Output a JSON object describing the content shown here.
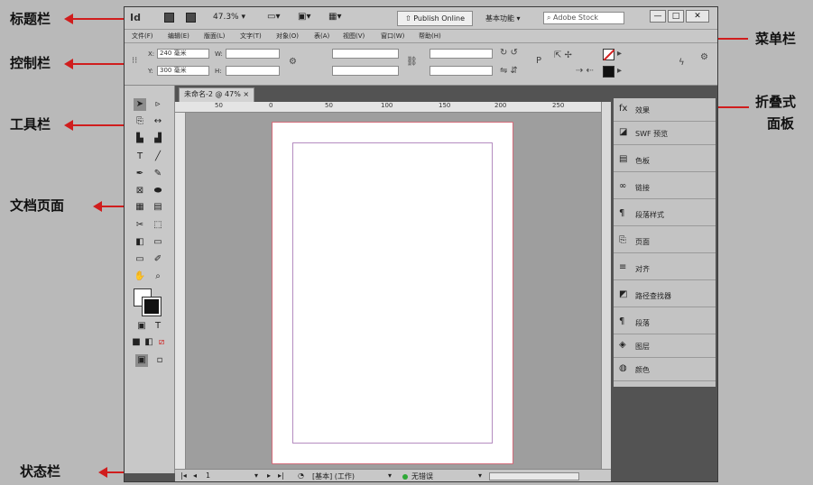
{
  "annotations": {
    "title_bar": "标题栏",
    "control_bar": "控制栏",
    "toolbar": "工具栏",
    "document_page": "文档页面",
    "status_bar": "状态栏",
    "menu_bar": "菜单栏",
    "collapsed_panels_line1": "折叠式",
    "collapsed_panels_line2": "面板"
  },
  "titlebar": {
    "logo": "Id",
    "zoom": "47.3%",
    "publish": "Publish Online",
    "workspace": "基本功能",
    "search_placeholder": "Adobe Stock",
    "minimize": "—",
    "maximize": "□",
    "close": "✕"
  },
  "menu": [
    "文件(F)",
    "编辑(E)",
    "版面(L)",
    "文字(T)",
    "对象(O)",
    "表(A)",
    "视图(V)",
    "窗口(W)",
    "帮助(H)"
  ],
  "control": {
    "x_label": "X:",
    "x_value": "240 毫米",
    "y_label": "Y:",
    "y_value": "300 毫米",
    "w_label": "W:",
    "h_label": "H:"
  },
  "document": {
    "tab_label": "未命名-2 @ 47% ×",
    "ruler_labels": [
      "50",
      "0",
      "50",
      "100",
      "150",
      "200",
      "250"
    ]
  },
  "status": {
    "page": "1",
    "profile": "[基本] (工作)",
    "errors": "无错误"
  },
  "panels": [
    {
      "icon": "fx",
      "label": "效果"
    },
    {
      "icon": "◪",
      "label": "SWF 预览"
    },
    {
      "icon": "▤",
      "label": "色板"
    },
    {
      "icon": "∞",
      "label": "链接"
    },
    {
      "icon": "¶",
      "label": "段落样式"
    },
    {
      "icon": "⎘",
      "label": "页面"
    },
    {
      "icon": "≡",
      "label": "对齐"
    },
    {
      "icon": "◩",
      "label": "路径查找器"
    },
    {
      "icon": "¶",
      "label": "段落"
    },
    {
      "icon": "◈",
      "label": "图层"
    },
    {
      "icon": "◍",
      "label": "颜色"
    }
  ],
  "colors": {
    "accent_arrow": "#d01d1d",
    "page_bleed": "#d26c7a",
    "margin_guide": "#b48cc0",
    "status_ok": "#2ea836"
  }
}
